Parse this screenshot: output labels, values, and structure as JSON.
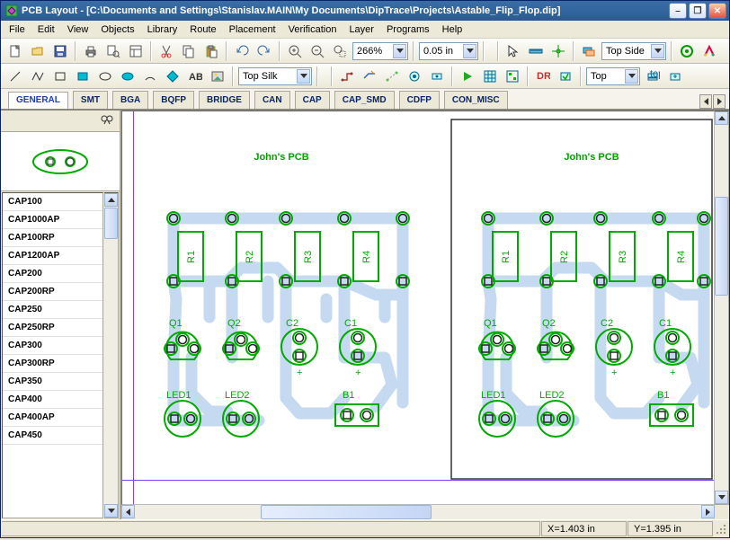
{
  "title": "PCB Layout - [C:\\Documents and Settings\\Stanislav.MAIN\\My Documents\\DipTrace\\Projects\\Astable_Flip_Flop.dip]",
  "menu": [
    "File",
    "Edit",
    "View",
    "Objects",
    "Library",
    "Route",
    "Placement",
    "Verification",
    "Layer",
    "Programs",
    "Help"
  ],
  "toolbar1": {
    "zoom": "266%",
    "grid": "0.05 in",
    "layer": "Top Side"
  },
  "toolbar2": {
    "layer": "Top Silk",
    "routelayer": "Top"
  },
  "tabs": [
    "GENERAL",
    "SMT",
    "BGA",
    "BQFP",
    "BRIDGE",
    "CAN",
    "CAP",
    "CAP_SMD",
    "CDFP",
    "CON_MISC"
  ],
  "active_tab": 0,
  "parts": [
    "CAP100",
    "CAP1000AP",
    "CAP100RP",
    "CAP1200AP",
    "CAP200",
    "CAP200RP",
    "CAP250",
    "CAP250RP",
    "CAP300",
    "CAP300RP",
    "CAP350",
    "CAP400",
    "CAP400AP",
    "CAP450"
  ],
  "pcb_title": "John's PCB",
  "refs": {
    "r": [
      "R1",
      "R2",
      "R3",
      "R4"
    ],
    "q": [
      "Q1",
      "Q2"
    ],
    "c": [
      "C2",
      "C1"
    ],
    "led": [
      "LED1",
      "LED2"
    ],
    "b": "B1"
  },
  "status": {
    "x": "X=1.403 in",
    "y": "Y=1.395 in"
  }
}
